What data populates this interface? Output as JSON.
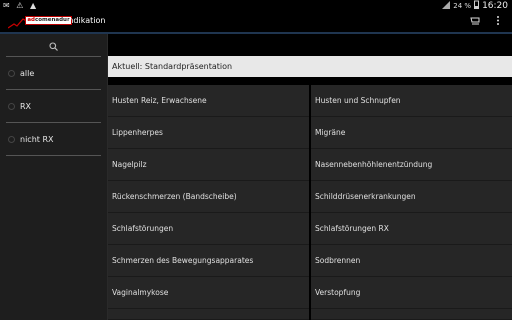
{
  "status": {
    "left_icons": "✉ ⚠ ▲",
    "battery": "24 %",
    "time": "16:20"
  },
  "app": {
    "title": "Indikation",
    "logo_text_a": "ad",
    "logo_text_b": "comenadur"
  },
  "sidebar": {
    "items": [
      {
        "label": "alle"
      },
      {
        "label": "RX"
      },
      {
        "label": "nicht RX"
      }
    ]
  },
  "main": {
    "current_label": "Aktuell: Standardpräsentation",
    "rows": [
      [
        "Husten Reiz,  Erwachsene",
        "Husten und Schnupfen"
      ],
      [
        "Lippenherpes",
        "Migräne"
      ],
      [
        "Nagelpilz",
        "Nasennebenhöhlenentzündung"
      ],
      [
        "Rückenschmerzen (Bandscheibe)",
        "Schilddrüsenerkrankungen"
      ],
      [
        "Schlafstörungen",
        "Schlafstörungen RX"
      ],
      [
        "Schmerzen des Bewegungsapparates",
        "Sodbrennen"
      ],
      [
        "Vaginalmykose",
        "Verstopfung"
      ],
      [
        "",
        ""
      ]
    ]
  }
}
